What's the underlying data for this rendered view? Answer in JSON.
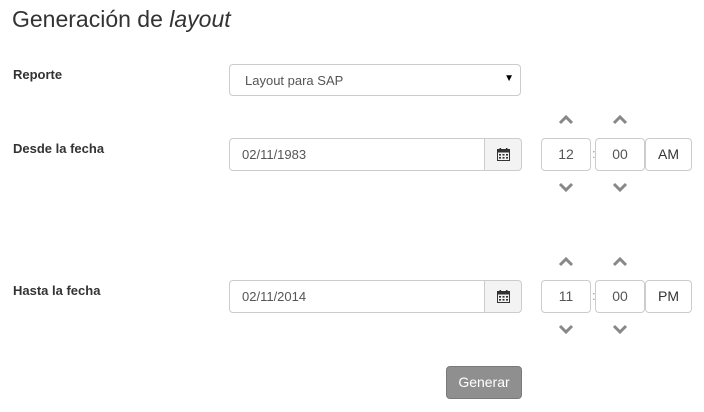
{
  "page": {
    "title_prefix": "Generación de",
    "title_italic": "layout"
  },
  "form": {
    "report_label": "Reporte",
    "report_value": "Layout para SAP",
    "from_label": "Desde la fecha",
    "from_date": "02/11/1983",
    "from_hour": "12",
    "from_minute": "00",
    "from_meridian": "AM",
    "to_label": "Hasta la fecha",
    "to_date": "02/11/2014",
    "to_hour": "11",
    "to_minute": "00",
    "to_meridian": "PM",
    "time_separator": ":",
    "submit_label": "Generar"
  },
  "icons": {
    "dropdown": "caret-down-icon",
    "calendar": "calendar-icon",
    "increment": "chevron-up-icon",
    "decrement": "chevron-down-icon"
  },
  "colors": {
    "submit_bg": "#8f8f8f",
    "border": "#cccccc",
    "chevron": "#888888"
  }
}
